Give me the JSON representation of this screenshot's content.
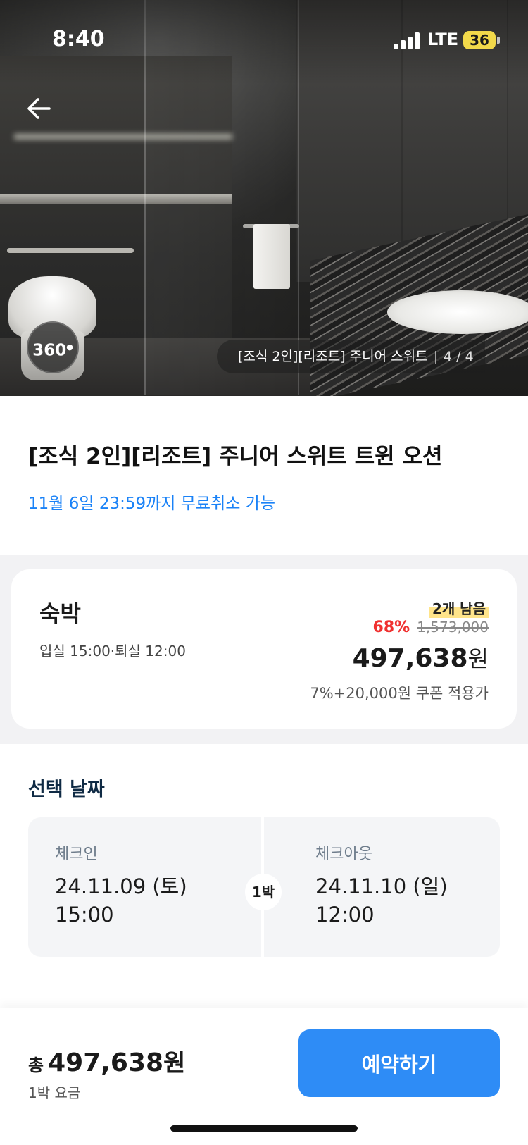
{
  "status_bar": {
    "time": "8:40",
    "network": "LTE",
    "battery": "36"
  },
  "hero": {
    "badge_360": "360",
    "caption": "[조식 2인][리조트] 주니어 스위트",
    "image_counter": "4 / 4"
  },
  "room": {
    "title": "[조식 2인][리조트] 주니어 스위트 트윈 오션",
    "cancel_notice": "11월 6일 23:59까지 무료취소 가능"
  },
  "offer": {
    "type": "숙박",
    "times": "입실 15:00·퇴실 12:00",
    "remaining": "2개 남음",
    "discount": "68%",
    "original_price": "1,573,000",
    "price": "497,638",
    "currency": "원",
    "coupon_note": "7%+20,000원 쿠폰 적용가"
  },
  "dates": {
    "section_title": "선택 날짜",
    "check_in_label": "체크인",
    "check_in_date": "24.11.09 (토)",
    "check_in_time": "15:00",
    "nights": "1박",
    "check_out_label": "체크아웃",
    "check_out_date": "24.11.10 (일)",
    "check_out_time": "12:00"
  },
  "footer": {
    "total_prefix": "총",
    "total_amount": "497,638",
    "total_currency": "원",
    "per_night": "1박 요금",
    "book_label": "예약하기"
  },
  "colors": {
    "accent_blue": "#2e8cf6",
    "link_blue": "#1a82f7",
    "discount_red": "#f0302f",
    "highlight_yellow": "#ffe48a"
  },
  "icons": {
    "back": "arrow-left-icon",
    "signal": "cellular-signal-icon",
    "battery": "battery-icon"
  }
}
